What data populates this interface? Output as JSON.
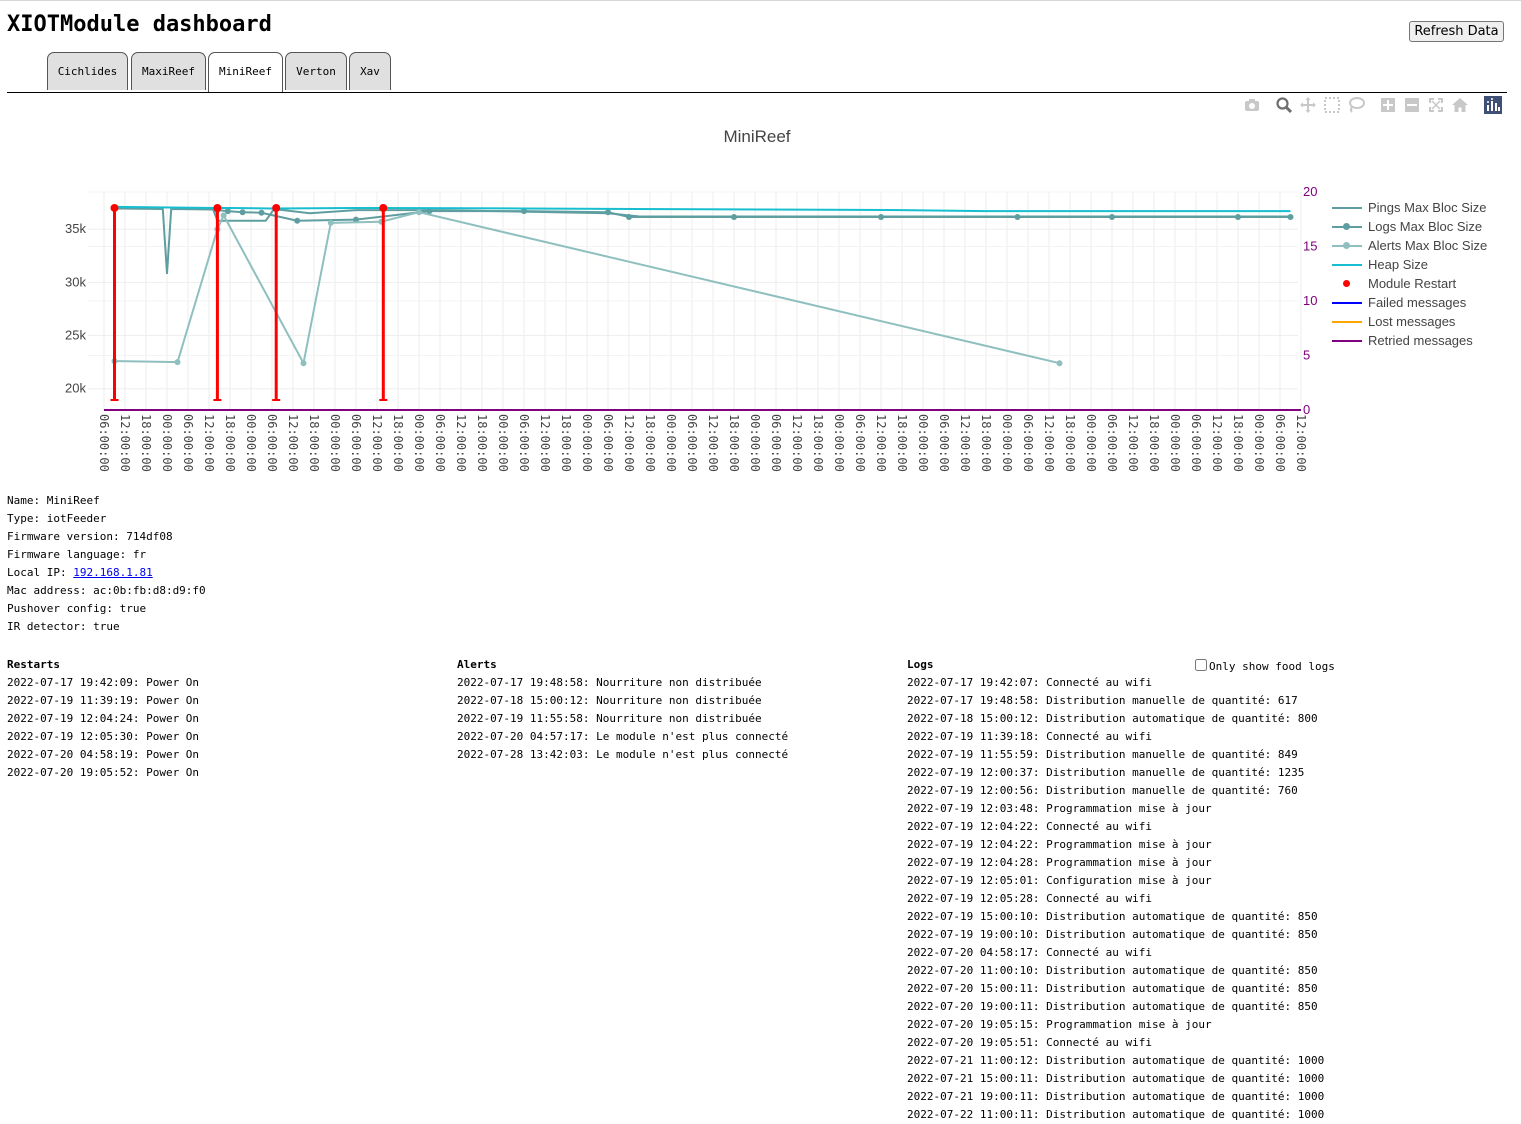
{
  "header": {
    "title": "XIOTModule dashboard",
    "refresh_label": "Refresh Data"
  },
  "tabs": [
    {
      "label": "Cichlides",
      "active": false
    },
    {
      "label": "MaxiReef",
      "active": false
    },
    {
      "label": "MiniReef",
      "active": true
    },
    {
      "label": "Verton",
      "active": false
    },
    {
      "label": "Xav",
      "active": false
    }
  ],
  "modebar": [
    "camera-icon",
    "zoom-icon",
    "pan-icon",
    "box-select-icon",
    "lasso-select-icon",
    "zoom-in-icon",
    "zoom-out-icon",
    "autoscale-icon",
    "reset-axes-icon",
    "plotly-logo-icon"
  ],
  "chart_data": {
    "type": "line",
    "title": "MiniReef",
    "xlabel": "",
    "ylabel": "",
    "y_ticks": [
      "35k",
      "30k",
      "25k",
      "20k"
    ],
    "y_ticks_values": [
      35000,
      30000,
      25000,
      20000
    ],
    "ylim": [
      18000,
      38500
    ],
    "y2_ticks": [
      "20",
      "15",
      "10",
      "5",
      "0"
    ],
    "y2lim": [
      0,
      20
    ],
    "y2_color": "#800080",
    "x_ticks": [
      "06:00:00",
      "12:00:00",
      "18:00:00",
      "00:00:00",
      "06:00:00",
      "12:00:00",
      "18:00:00",
      "00:00:00",
      "06:00:00",
      "12:00:00",
      "18:00:00",
      "00:00:00",
      "06:00:00",
      "12:00:00",
      "18:00:00",
      "00:00:00",
      "06:00:00",
      "12:00:00",
      "18:00:00",
      "00:00:00",
      "06:00:00",
      "12:00:00",
      "18:00:00",
      "00:00:00",
      "06:00:00",
      "12:00:00",
      "18:00:00",
      "00:00:00",
      "06:00:00",
      "12:00:00",
      "18:00:00",
      "00:00:00",
      "06:00:00",
      "12:00:00",
      "18:00:00",
      "00:00:00",
      "06:00:00",
      "12:00:00",
      "18:00:00",
      "00:00:00",
      "06:00:00",
      "12:00:00",
      "18:00:00",
      "00:00:00",
      "06:00:00",
      "12:00:00",
      "18:00:00",
      "00:00:00",
      "06:00:00",
      "12:00:00",
      "18:00:00",
      "00:00:00",
      "06:00:00",
      "12:00:00",
      "18:00:00",
      "00:00:00",
      "06:00:00",
      "12:00:00"
    ],
    "grid": true,
    "legend_position": "right",
    "series": [
      {
        "name": "Pings Max Bloc Size",
        "color": "#5f9ea0",
        "axis": "y",
        "mode": "lines",
        "x": [
          0.5,
          2.8,
          3.0,
          3.2,
          5.2,
          5.4,
          7.7,
          8.1,
          9.8,
          12.0,
          15.9,
          24.0,
          25.5,
          32.0,
          38.0,
          44.0,
          49.0,
          56.5
        ],
        "y": [
          36950,
          36900,
          30800,
          36900,
          36850,
          35800,
          35800,
          36900,
          36500,
          36800,
          36800,
          36500,
          36200,
          36200,
          36200,
          36200,
          36200,
          36200
        ]
      },
      {
        "name": "Logs Max Bloc Size",
        "color": "#5f9ea0",
        "axis": "y",
        "mode": "lines+markers",
        "x": [
          5.4,
          5.9,
          6.6,
          7.5,
          9.2,
          12.0,
          15.5,
          20.0,
          24.0,
          25.0,
          30.0,
          37.0,
          43.5,
          48.0,
          54.0,
          56.5
        ],
        "y": [
          36800,
          36700,
          36600,
          36550,
          35800,
          35900,
          36700,
          36700,
          36600,
          36150,
          36150,
          36150,
          36150,
          36150,
          36150,
          36150
        ]
      },
      {
        "name": "Alerts Max Bloc Size",
        "color": "#8fbfbf",
        "axis": "y",
        "mode": "lines+markers",
        "x": [
          0.5,
          3.5,
          5.4,
          5.7,
          9.5,
          10.8,
          13.2,
          15.0,
          45.5
        ],
        "y": [
          22600,
          22500,
          35000,
          36300,
          22400,
          35600,
          35700,
          36600,
          22400
        ]
      },
      {
        "name": "Heap Size",
        "color": "#17becf",
        "axis": "y",
        "mode": "lines",
        "x": [
          0.5,
          5.3,
          6.0,
          8.0,
          12.0,
          20.0,
          38.0,
          42.0,
          56.5
        ],
        "y": [
          37100,
          37000,
          37000,
          36950,
          37000,
          36950,
          36800,
          36700,
          36700
        ]
      },
      {
        "name": "Module Restart",
        "color": "#ff0000",
        "axis": "y",
        "mode": "markers",
        "x": [
          0.5,
          5.4,
          8.2,
          13.3
        ],
        "y": [
          37000,
          37000,
          37000,
          37000
        ]
      },
      {
        "name": "Failed messages",
        "color": "#0000ff",
        "axis": "y2",
        "mode": "lines",
        "x": [
          0,
          57
        ],
        "y": [
          0,
          0
        ]
      },
      {
        "name": "Lost messages",
        "color": "#ffa500",
        "axis": "y2",
        "mode": "lines",
        "x": [
          0,
          57
        ],
        "y": [
          0,
          0
        ]
      },
      {
        "name": "Retried messages",
        "color": "#800080",
        "axis": "y2",
        "mode": "lines",
        "x": [
          0,
          57
        ],
        "y": [
          0,
          0
        ]
      }
    ]
  },
  "module_info": [
    {
      "label": "Name: ",
      "value": "MiniReef"
    },
    {
      "label": "Type: ",
      "value": "iotFeeder"
    },
    {
      "label": "Firmware version: ",
      "value": "714df08"
    },
    {
      "label": "Firmware language: ",
      "value": "fr"
    },
    {
      "label": "Local IP: ",
      "value": "192.168.1.81",
      "link": true
    },
    {
      "label": "Mac address: ",
      "value": "ac:0b:fb:d8:d9:f0"
    },
    {
      "label": "Pushover config: ",
      "value": "true"
    },
    {
      "label": "IR detector: ",
      "value": "true"
    }
  ],
  "restarts": {
    "title": "Restarts",
    "items": [
      "2022-07-17 19:42:09: Power On",
      "2022-07-19 11:39:19: Power On",
      "2022-07-19 12:04:24: Power On",
      "2022-07-19 12:05:30: Power On",
      "2022-07-20 04:58:19: Power On",
      "2022-07-20 19:05:52: Power On"
    ]
  },
  "alerts": {
    "title": "Alerts",
    "items": [
      "2022-07-17 19:48:58: Nourriture non distribuée",
      "2022-07-18 15:00:12: Nourriture non distribuée",
      "2022-07-19 11:55:58: Nourriture non distribuée",
      "2022-07-20 04:57:17: Le module n'est plus connecté",
      "2022-07-28 13:42:03: Le module n'est plus connecté"
    ]
  },
  "logs": {
    "title": "Logs",
    "filter_label": "Only show food logs",
    "filter_checked": false,
    "items": [
      "2022-07-17 19:42:07: Connecté au wifi",
      "2022-07-17 19:48:58: Distribution manuelle de quantité: 617",
      "2022-07-18 15:00:12: Distribution automatique de quantité: 800",
      "2022-07-19 11:39:18: Connecté au wifi",
      "2022-07-19 11:55:59: Distribution manuelle de quantité: 849",
      "2022-07-19 12:00:37: Distribution manuelle de quantité: 1235",
      "2022-07-19 12:00:56: Distribution manuelle de quantité: 760",
      "2022-07-19 12:03:48: Programmation mise à jour",
      "2022-07-19 12:04:22: Connecté au wifi",
      "2022-07-19 12:04:22: Programmation mise à jour",
      "2022-07-19 12:04:28: Programmation mise à jour",
      "2022-07-19 12:05:01: Configuration mise à jour",
      "2022-07-19 12:05:28: Connecté au wifi",
      "2022-07-19 15:00:10: Distribution automatique de quantité: 850",
      "2022-07-19 19:00:10: Distribution automatique de quantité: 850",
      "2022-07-20 04:58:17: Connecté au wifi",
      "2022-07-20 11:00:10: Distribution automatique de quantité: 850",
      "2022-07-20 15:00:11: Distribution automatique de quantité: 850",
      "2022-07-20 19:00:11: Distribution automatique de quantité: 850",
      "2022-07-20 19:05:15: Programmation mise à jour",
      "2022-07-20 19:05:51: Connecté au wifi",
      "2022-07-21 11:00:12: Distribution automatique de quantité: 1000",
      "2022-07-21 15:00:11: Distribution automatique de quantité: 1000",
      "2022-07-21 19:00:11: Distribution automatique de quantité: 1000",
      "2022-07-22 11:00:11: Distribution automatique de quantité: 1000"
    ]
  }
}
